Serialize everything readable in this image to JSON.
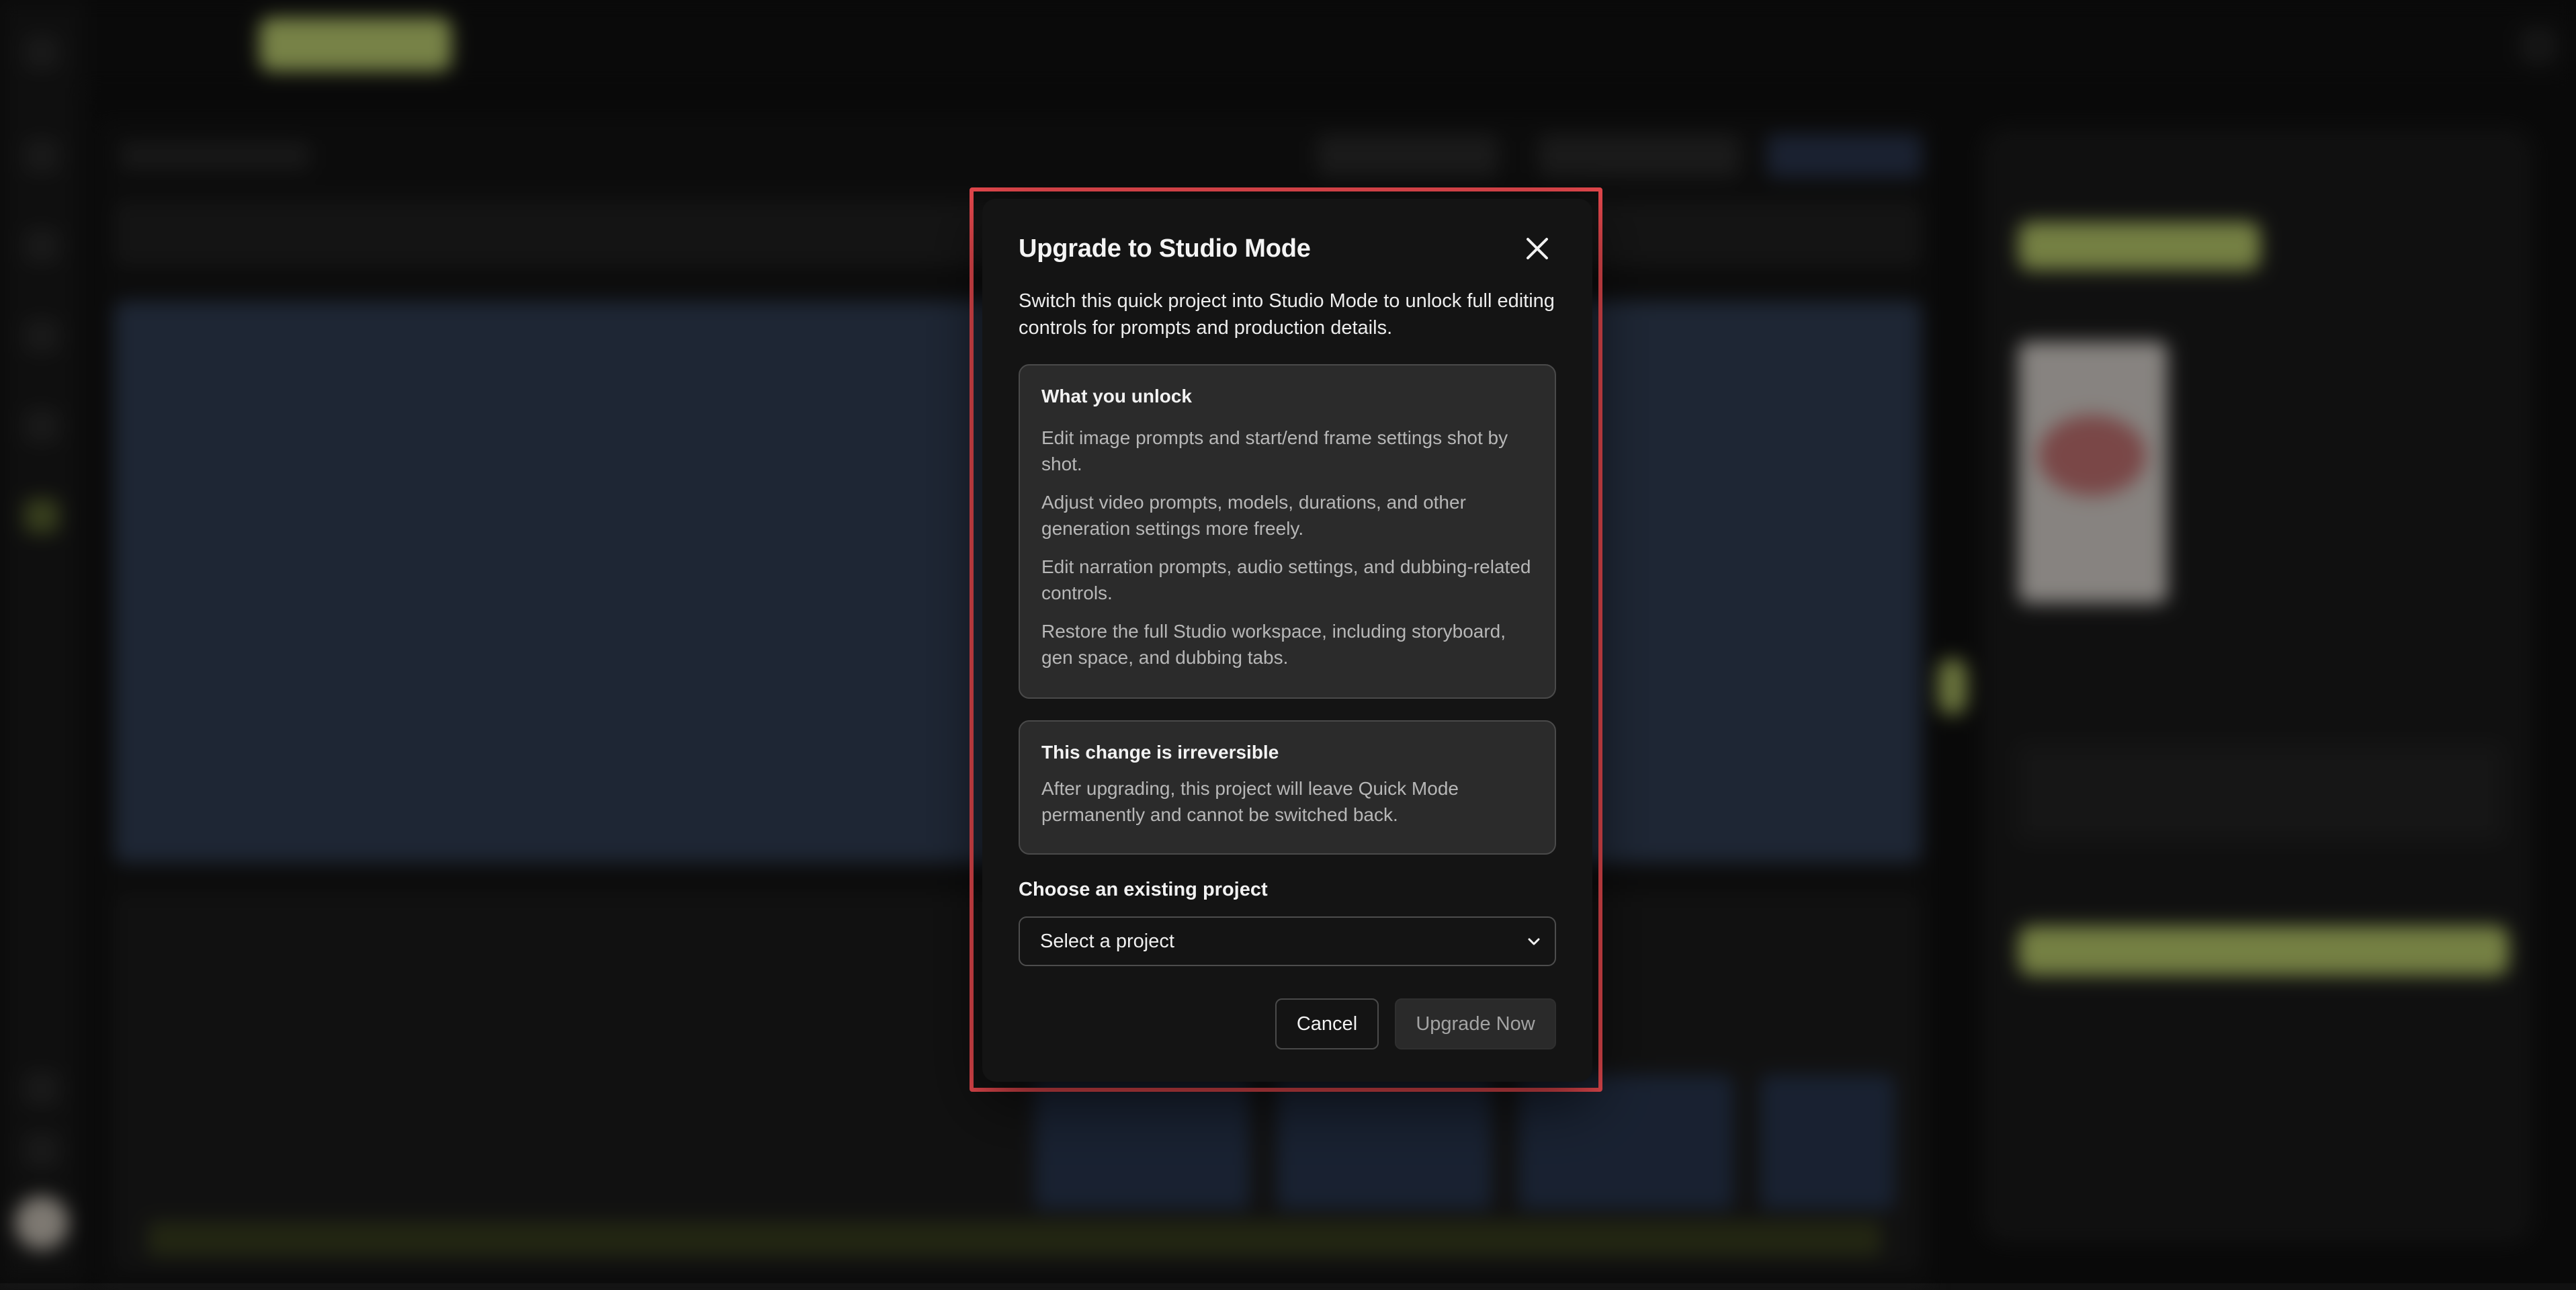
{
  "modal": {
    "title": "Upgrade to Studio Mode",
    "close_icon": "close-icon",
    "description": "Switch this quick project into Studio Mode to unlock full editing controls for prompts and production details.",
    "unlock_card": {
      "title": "What you unlock",
      "items": [
        "Edit image prompts and start/end frame settings shot by shot.",
        "Adjust video prompts, models, durations, and other generation settings more freely.",
        "Edit narration prompts, audio settings, and dubbing-related controls.",
        "Restore the full Studio workspace, including storyboard, gen space, and dubbing tabs."
      ]
    },
    "irreversible_card": {
      "title": "This change is irreversible",
      "body": "After upgrading, this project will leave Quick Mode permanently and cannot be switched back."
    },
    "project_select": {
      "label": "Choose an existing project",
      "value": "Select a project",
      "icon": "chevron-down-icon"
    },
    "cancel_label": "Cancel",
    "upgrade_label": "Upgrade Now"
  },
  "colors": {
    "highlight_border": "#e5484d",
    "accent": "#cde07a",
    "modal_bg": "#141414",
    "card_bg": "#2b2b2b"
  }
}
